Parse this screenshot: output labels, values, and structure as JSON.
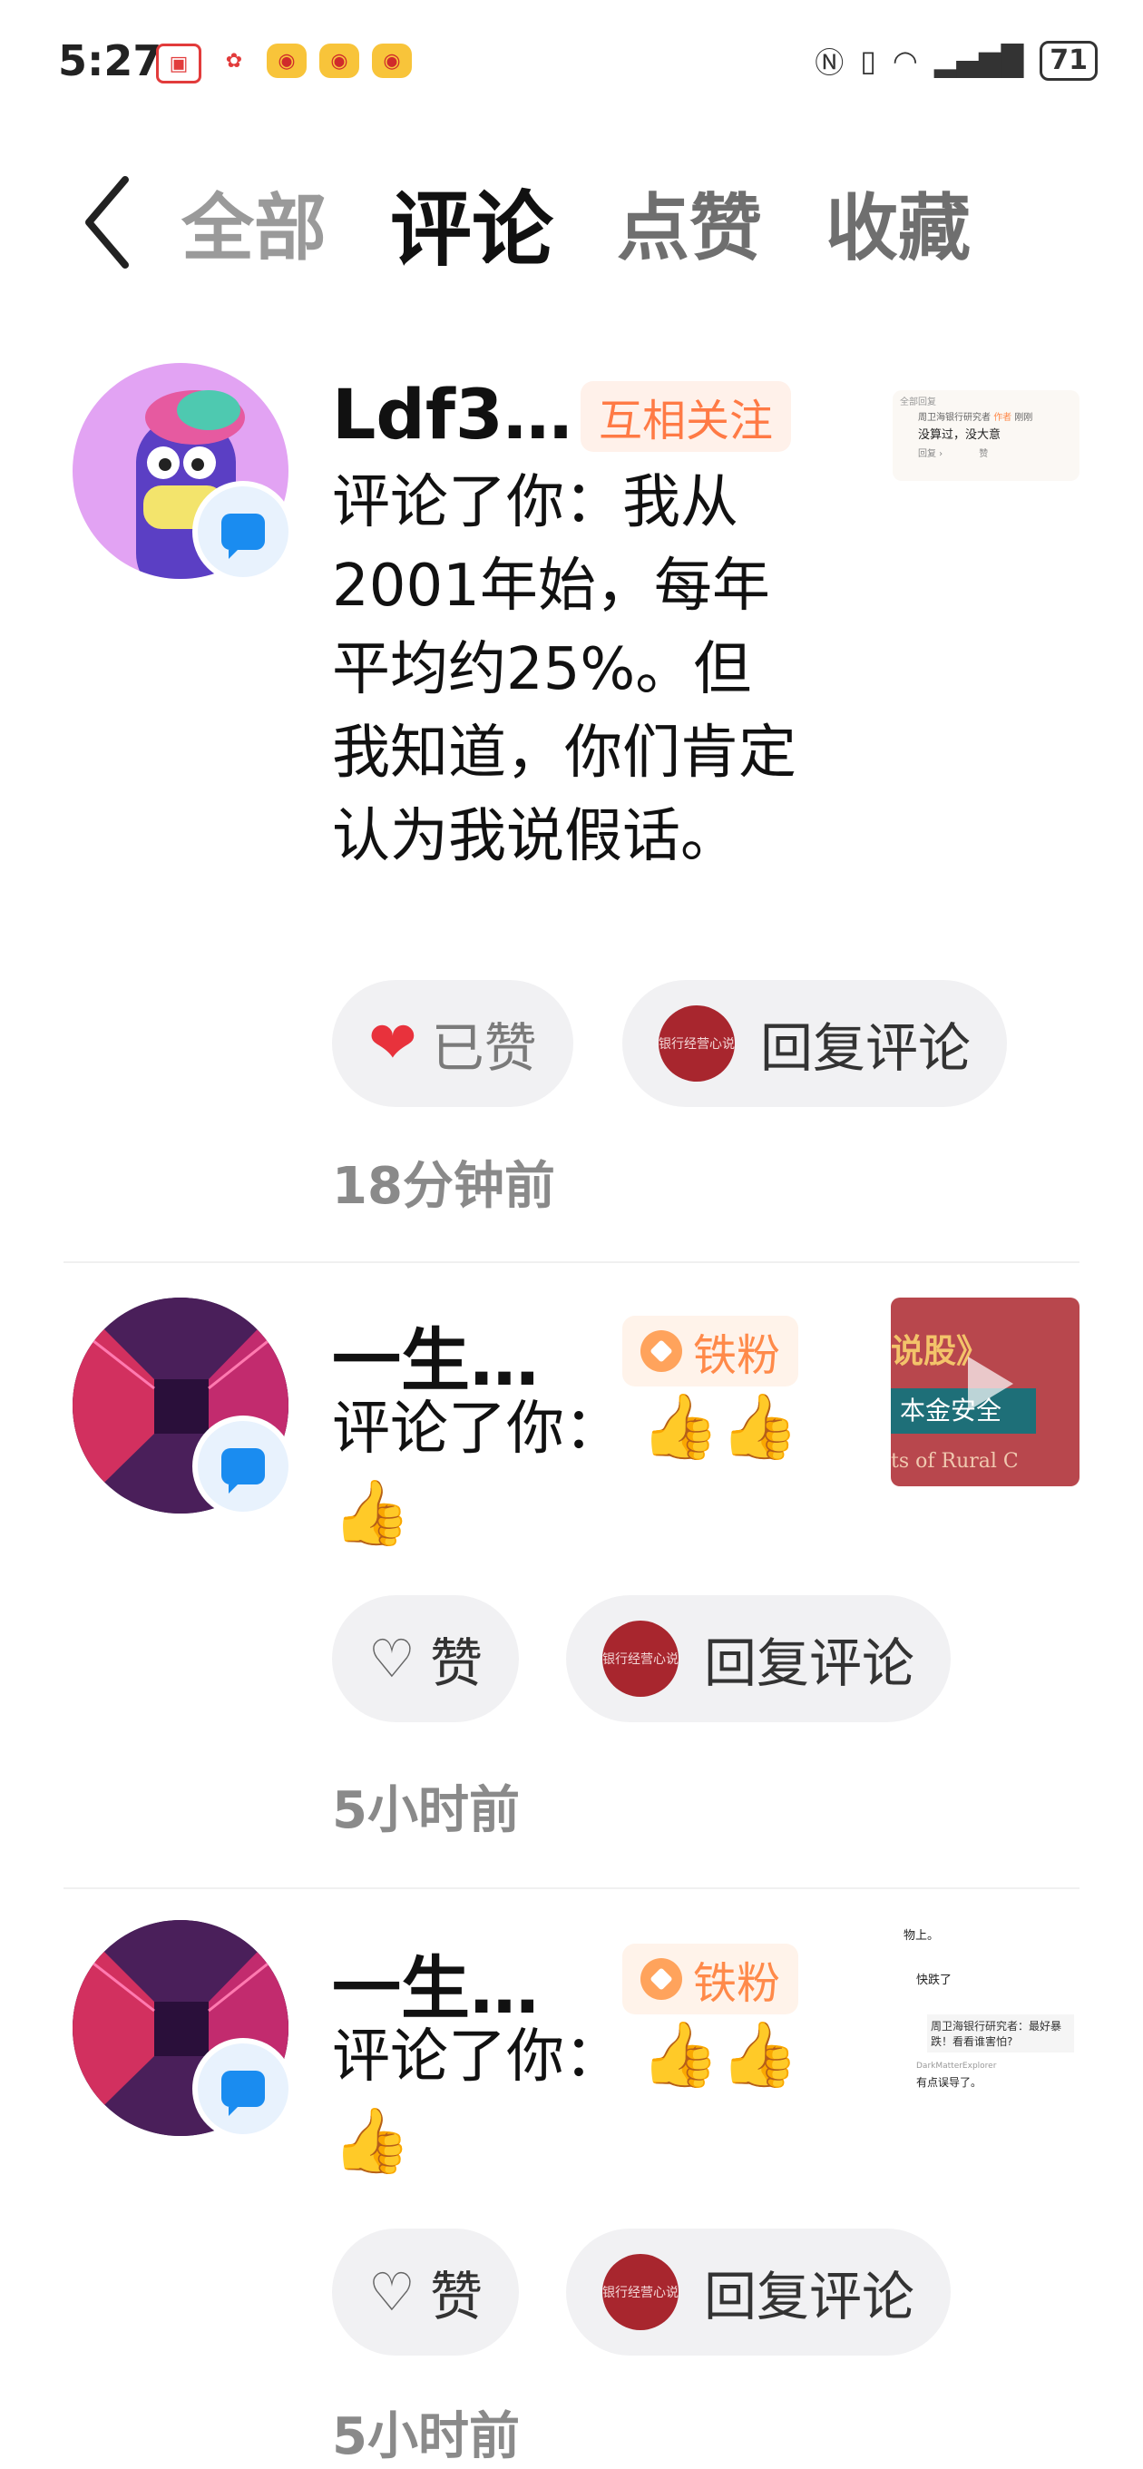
{
  "status_bar": {
    "time": "5:27",
    "battery": "71"
  },
  "tabs": [
    {
      "label": "全部"
    },
    {
      "label": "评论"
    },
    {
      "label": "点赞"
    },
    {
      "label": "收藏"
    }
  ],
  "notifications": [
    {
      "name": "Ldf3…",
      "tag": "互相关注",
      "text": "评论了你：我从2001年始，每年平均约25%。但我知道，你们肯定认为我说假话。",
      "like_label": "已赞",
      "reply_label": "回复评论",
      "time": "18分钟前",
      "thumb": {
        "header": "全部回复",
        "author": "周卫海银行研究者",
        "badge": "作者",
        "ago": "刚刚",
        "comment": "没算过，没大意",
        "reply_btn": "回复 ›",
        "like": "赞"
      }
    },
    {
      "name": "一生…",
      "tag": "铁粉",
      "text_prefix": "评论了你：",
      "like_label": "赞",
      "reply_label": "回复评论",
      "time": "5小时前",
      "thumb": {
        "line1": "说股》",
        "line2": "本金安全",
        "line3": "ts of Rural C"
      }
    },
    {
      "name": "一生…",
      "tag": "铁粉",
      "text_prefix": "评论了你：",
      "like_label": "赞",
      "reply_label": "回复评论",
      "time": "5小时前",
      "thumb": {
        "l1": "物上。",
        "l2": "快跌了",
        "l3": "周卫海银行研究者：最好暴跌！看看谁害怕?",
        "l4": "DarkMatterExplorer",
        "l5": "有点误导了。"
      }
    }
  ],
  "colors": {
    "accent": "#ff7a45",
    "like": "#e8323c",
    "badge": "#1a8cf0"
  }
}
